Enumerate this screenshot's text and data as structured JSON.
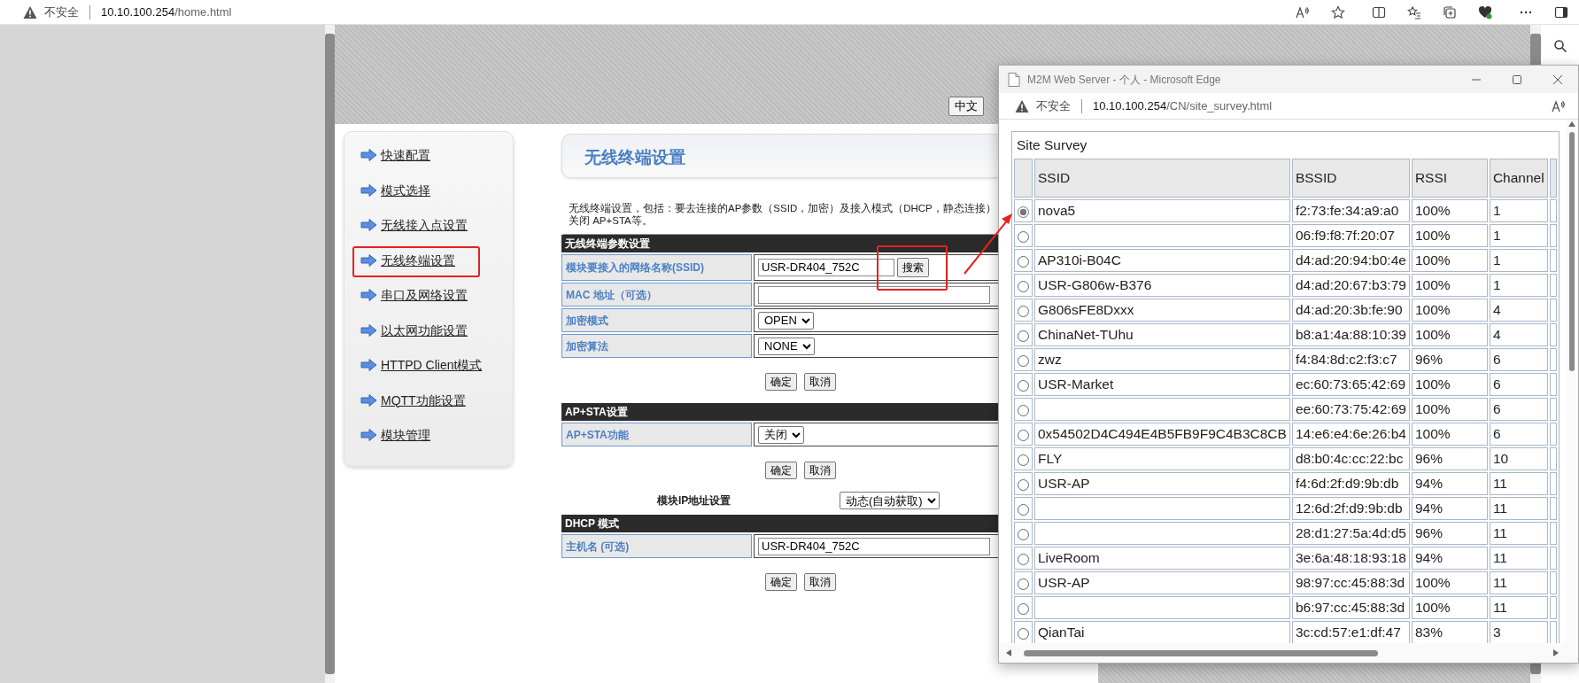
{
  "browser": {
    "security": "不安全",
    "url_host": "10.10.100.254",
    "url_path": "/home.html"
  },
  "page": {
    "language_button": "中文",
    "sidebar": {
      "items": [
        {
          "label": "快速配置",
          "highlighted": false
        },
        {
          "label": "模式选择",
          "highlighted": false
        },
        {
          "label": "无线接入点设置",
          "highlighted": false
        },
        {
          "label": "无线终端设置",
          "highlighted": true
        },
        {
          "label": "串口及网络设置",
          "highlighted": false
        },
        {
          "label": "以太网功能设置",
          "highlighted": false
        },
        {
          "label": "HTTPD Client模式",
          "highlighted": false
        },
        {
          "label": "MQTT功能设置",
          "highlighted": false
        },
        {
          "label": "模块管理",
          "highlighted": false
        }
      ]
    },
    "title": "无线终端设置",
    "description": [
      "无线终端设置，包括：要去连接的AP参数（SSID，加密）及接入模式（DHCP，静态连接）",
      "关闭 AP+STA等。"
    ],
    "sections": [
      {
        "kind": "panel",
        "title": "无线终端参数设置",
        "rows": [
          {
            "kind": "text",
            "label": "模块要接入的网络名称(SSID)",
            "value": "USR-DR404_752C",
            "button": "搜索",
            "button_highlighted": true
          },
          {
            "kind": "text",
            "label": "MAC 地址（可选）"
          },
          {
            "kind": "select",
            "label": "加密模式",
            "value": "OPEN"
          },
          {
            "kind": "select",
            "label": "加密算法",
            "value": "NONE"
          }
        ],
        "buttons": [
          "确定",
          "取消"
        ]
      },
      {
        "kind": "panel",
        "title": "AP+STA设置",
        "rows": [
          {
            "kind": "select",
            "label": "AP+STA功能",
            "value": "关闭"
          }
        ],
        "buttons": [
          "确定",
          "取消"
        ]
      },
      {
        "kind": "inline",
        "label": "模块IP地址设置",
        "value": "动态(自动获取)"
      },
      {
        "kind": "panel",
        "title": "DHCP 模式",
        "rows": [
          {
            "kind": "text",
            "label": "主机名 (可选)",
            "value": "USR-DR404_752C"
          }
        ],
        "buttons": [
          "确定",
          "取消"
        ]
      }
    ]
  },
  "popup": {
    "title": "M2M Web Server - 个人 - Microsoft Edge",
    "security": "不安全",
    "url_host": "10.10.100.254",
    "url_path": "/CN/site_survey.html",
    "table": {
      "caption": "Site Survey",
      "columns": [
        "SSID",
        "BSSID",
        "RSSI",
        "Channel"
      ],
      "rows": [
        {
          "selected": true,
          "cells": [
            "nova5",
            "f2:73:fe:34:a9:a0",
            "100%",
            "1"
          ]
        },
        {
          "selected": false,
          "cells": [
            "",
            "06:f9:f8:7f:20:07",
            "100%",
            "1"
          ]
        },
        {
          "selected": false,
          "cells": [
            "AP310i-B04C",
            "d4:ad:20:94:b0:4e",
            "100%",
            "1"
          ]
        },
        {
          "selected": false,
          "cells": [
            "USR-G806w-B376",
            "d4:ad:20:67:b3:79",
            "100%",
            "1"
          ]
        },
        {
          "selected": false,
          "cells": [
            "G806sFE8Dxxx",
            "d4:ad:20:3b:fe:90",
            "100%",
            "4"
          ]
        },
        {
          "selected": false,
          "cells": [
            "ChinaNet-TUhu",
            "b8:a1:4a:88:10:39",
            "100%",
            "4"
          ]
        },
        {
          "selected": false,
          "cells": [
            "zwz",
            "f4:84:8d:c2:f3:c7",
            "96%",
            "6"
          ]
        },
        {
          "selected": false,
          "cells": [
            "USR-Market",
            "ec:60:73:65:42:69",
            "100%",
            "6"
          ]
        },
        {
          "selected": false,
          "cells": [
            "",
            "ee:60:73:75:42:69",
            "100%",
            "6"
          ]
        },
        {
          "selected": false,
          "cells": [
            "0x54502D4C494E4B5FB9F9C4B3C8CB",
            "14:e6:e4:6e:26:b4",
            "100%",
            "6"
          ]
        },
        {
          "selected": false,
          "cells": [
            "FLY",
            "d8:b0:4c:cc:22:bc",
            "96%",
            "10"
          ]
        },
        {
          "selected": false,
          "cells": [
            "USR-AP",
            "f4:6d:2f:d9:9b:db",
            "94%",
            "11"
          ]
        },
        {
          "selected": false,
          "cells": [
            "",
            "12:6d:2f:d9:9b:db",
            "94%",
            "11"
          ]
        },
        {
          "selected": false,
          "cells": [
            "",
            "28:d1:27:5a:4d:d5",
            "96%",
            "11"
          ]
        },
        {
          "selected": false,
          "cells": [
            "LiveRoom",
            "3e:6a:48:18:93:18",
            "94%",
            "11"
          ]
        },
        {
          "selected": false,
          "cells": [
            "USR-AP",
            "98:97:cc:45:88:3d",
            "100%",
            "11"
          ]
        },
        {
          "selected": false,
          "cells": [
            "",
            "b6:97:cc:45:88:3d",
            "100%",
            "11"
          ]
        },
        {
          "selected": false,
          "cells": [
            "QianTai",
            "3c:cd:57:e1:df:47",
            "83%",
            "3"
          ]
        }
      ]
    }
  }
}
